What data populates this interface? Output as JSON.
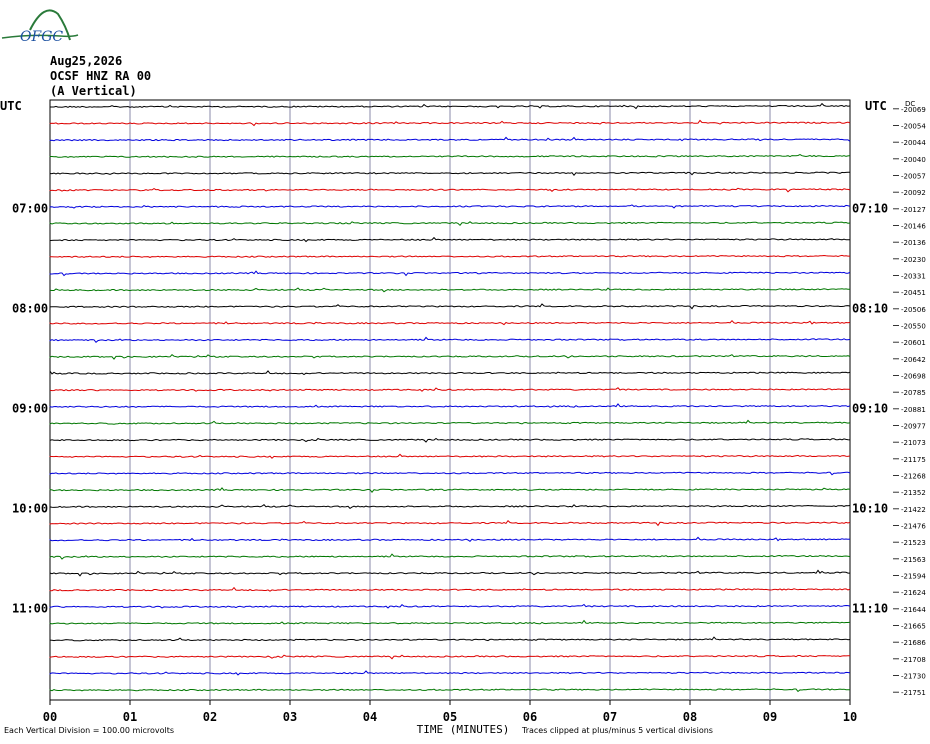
{
  "logo": {
    "text": "OFGC"
  },
  "header": {
    "date": "Aug25,2026",
    "station": "OCSF HNZ RA 00",
    "component": "(A Vertical)"
  },
  "axes": {
    "left_timezone": "UTC",
    "right_timezone": "UTC",
    "xlabel": "TIME (MINUTES)"
  },
  "footer": {
    "scale_note": "Each Vertical Division = 100.00 microvolts",
    "clip_note": "Traces clipped at plus/minus 5 vertical divisions"
  },
  "colors": {
    "black": "#000000",
    "red": "#dd0000",
    "blue": "#0000dd",
    "green": "#007700",
    "grid": "#8888aa"
  },
  "chart_data": {
    "type": "line",
    "x_ticks": [
      "00",
      "01",
      "02",
      "03",
      "04",
      "05",
      "06",
      "07",
      "08",
      "09",
      "10"
    ],
    "xlim": [
      0,
      10
    ],
    "trace_color_cycle": [
      "black",
      "red",
      "blue",
      "green"
    ],
    "left_hour_labels": [
      "07:00",
      "08:00",
      "09:00",
      "10:00",
      "11:00"
    ],
    "right_hour_labels": [
      "07:10",
      "08:10",
      "09:10",
      "10:10",
      "11:10"
    ],
    "hour_label_rows": [
      6,
      12,
      18,
      24,
      30
    ],
    "right_values": [
      "-20069",
      "-20054",
      "-20044",
      "-20040",
      "-20057",
      "-20092",
      "-20127",
      "-20146",
      "-20136",
      "-20230",
      "-20331",
      "-20451",
      "-20506",
      "-20550",
      "-20601",
      "-20642",
      "-20698",
      "-20785",
      "-20881",
      "-20977",
      "-21073",
      "-21175",
      "-21268",
      "-21352",
      "-21422",
      "-21476",
      "-21523",
      "-21563",
      "-21594",
      "-21624",
      "-21644",
      "-21665",
      "-21686",
      "-21708",
      "-21730",
      "-21751"
    ],
    "right_top_label": "DC"
  }
}
